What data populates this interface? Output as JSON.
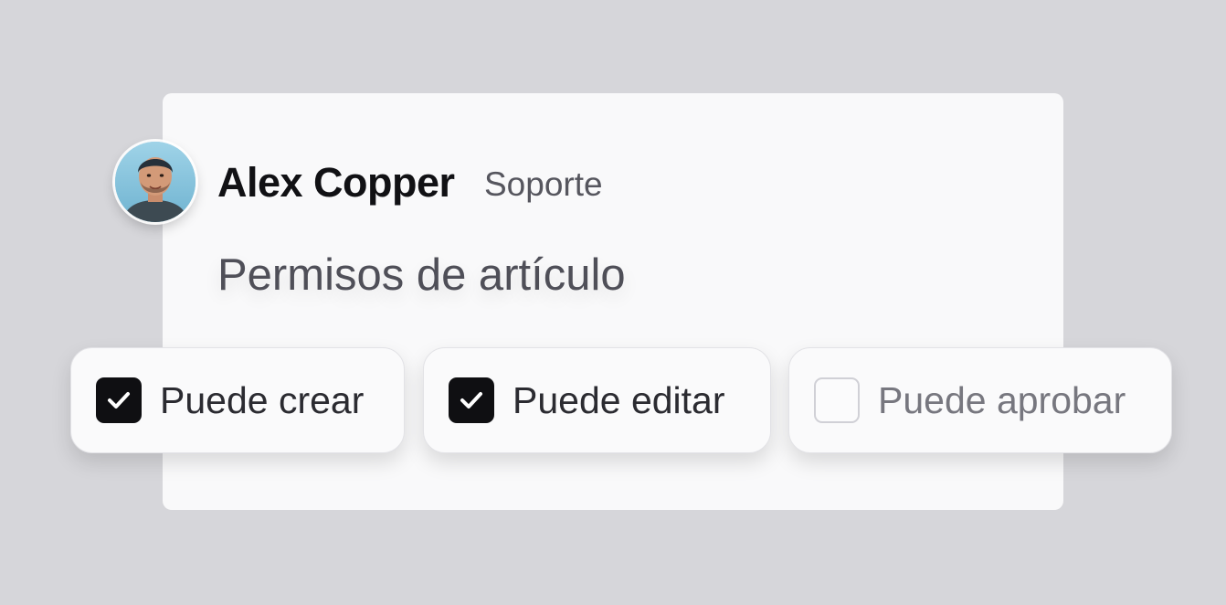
{
  "user": {
    "name": "Alex Copper",
    "role": "Soporte"
  },
  "section": {
    "title": "Permisos de artículo"
  },
  "permissions": [
    {
      "label": "Puede crear",
      "checked": true
    },
    {
      "label": "Puede editar",
      "checked": true
    },
    {
      "label": "Puede aprobar",
      "checked": false
    }
  ],
  "colors": {
    "background": "#d6d6da",
    "card": "#f9f9fa",
    "checkbox_checked": "#0f0f12",
    "checkbox_unchecked_border": "#d0d0d6"
  },
  "icons": {
    "check": "check-icon",
    "avatar": "avatar-photo"
  }
}
